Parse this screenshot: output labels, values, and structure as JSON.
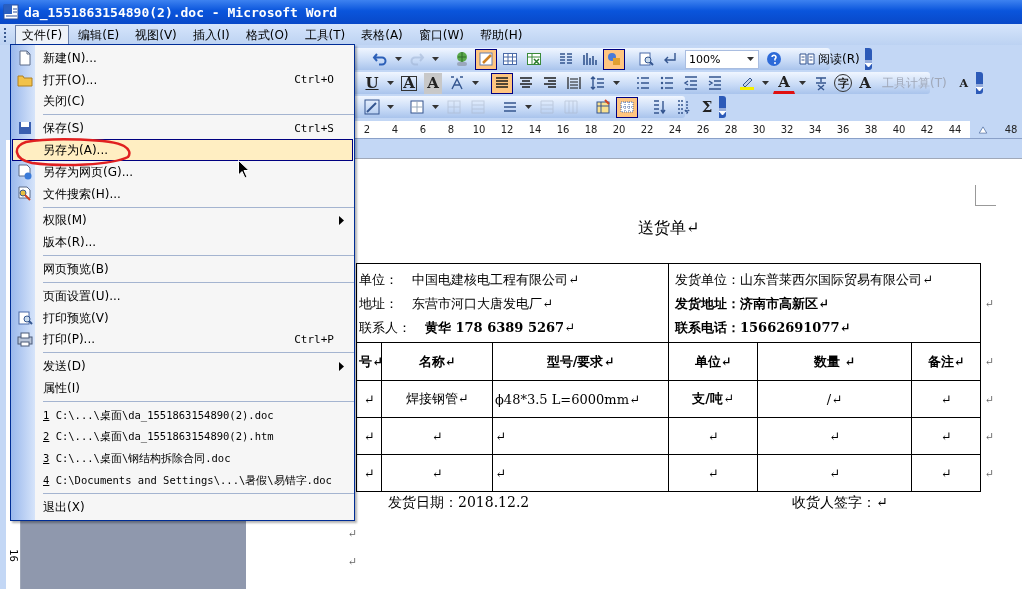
{
  "window": {
    "title": "da_1551863154890(2).doc - Microsoft Word"
  },
  "menu_bar": [
    {
      "label": "文件(F)",
      "selected": true
    },
    {
      "label": "编辑(E)",
      "selected": false
    },
    {
      "label": "视图(V)",
      "selected": false
    },
    {
      "label": "插入(I)",
      "selected": false
    },
    {
      "label": "格式(O)",
      "selected": false
    },
    {
      "label": "工具(T)",
      "selected": false
    },
    {
      "label": "表格(A)",
      "selected": false
    },
    {
      "label": "窗口(W)",
      "selected": false
    },
    {
      "label": "帮助(H)",
      "selected": false
    }
  ],
  "toolbars": [
    [
      {
        "kind": "separator"
      },
      {
        "kind": "icon",
        "selected": false,
        "disabled": false
      },
      {
        "kind": "dropdown"
      },
      {
        "kind": "icon",
        "selected": false,
        "disabled": true
      },
      {
        "kind": "dropdown"
      },
      {
        "kind": "separator"
      },
      {
        "kind": "icon",
        "selected": false,
        "disabled": false
      },
      {
        "kind": "icon",
        "selected": true,
        "disabled": false
      },
      {
        "kind": "icon",
        "selected": false,
        "disabled": false
      },
      {
        "kind": "icon",
        "selected": false,
        "disabled": false
      },
      {
        "kind": "separator"
      },
      {
        "kind": "icon",
        "selected": false,
        "disabled": false
      },
      {
        "kind": "icon",
        "selected": false,
        "disabled": false
      },
      {
        "kind": "icon",
        "selected": true,
        "disabled": false
      },
      {
        "kind": "separator"
      },
      {
        "kind": "icon",
        "selected": false,
        "disabled": false
      },
      {
        "kind": "icon",
        "selected": false,
        "disabled": false
      },
      {
        "kind": "zoom_field",
        "value": "100%"
      },
      {
        "kind": "icon",
        "selected": false,
        "disabled": false
      },
      {
        "kind": "separator"
      },
      {
        "kind": "text_button",
        "label": "阅读(R)",
        "disabled": false
      },
      {
        "kind": "chevron"
      }
    ],
    [
      {
        "kind": "glyph",
        "text": "U",
        "selected": false
      },
      {
        "kind": "dropdown"
      },
      {
        "kind": "glyph",
        "text": "A",
        "selected": false
      },
      {
        "kind": "glyph",
        "text": "A",
        "selected": false
      },
      {
        "kind": "icon",
        "selected": false,
        "disabled": false
      },
      {
        "kind": "dropdown"
      },
      {
        "kind": "separator"
      },
      {
        "kind": "icon",
        "selected": true,
        "disabled": false
      },
      {
        "kind": "icon",
        "selected": false,
        "disabled": false
      },
      {
        "kind": "icon",
        "selected": false,
        "disabled": false
      },
      {
        "kind": "icon",
        "selected": false,
        "disabled": false
      },
      {
        "kind": "icon",
        "selected": false,
        "disabled": false
      },
      {
        "kind": "dropdown"
      },
      {
        "kind": "separator"
      },
      {
        "kind": "icon",
        "selected": false,
        "disabled": false
      },
      {
        "kind": "icon",
        "selected": false,
        "disabled": false
      },
      {
        "kind": "icon",
        "selected": false,
        "disabled": false
      },
      {
        "kind": "icon",
        "selected": false,
        "disabled": false
      },
      {
        "kind": "separator"
      },
      {
        "kind": "icon",
        "selected": false,
        "disabled": false
      },
      {
        "kind": "dropdown"
      },
      {
        "kind": "glyph",
        "text": "A",
        "selected": false
      },
      {
        "kind": "dropdown"
      },
      {
        "kind": "icon",
        "selected": false,
        "disabled": false
      },
      {
        "kind": "glyph",
        "text": "字",
        "selected": false
      },
      {
        "kind": "glyph",
        "text": "A",
        "selected": false
      },
      {
        "kind": "text_button",
        "label": "工具计算(T)",
        "disabled": true
      },
      {
        "kind": "glyph",
        "text": "A",
        "selected": false
      },
      {
        "kind": "chevron"
      }
    ],
    [
      {
        "kind": "icon",
        "selected": false,
        "disabled": false
      },
      {
        "kind": "dropdown"
      },
      {
        "kind": "separator"
      },
      {
        "kind": "icon",
        "selected": false,
        "disabled": false
      },
      {
        "kind": "dropdown"
      },
      {
        "kind": "icon",
        "selected": false,
        "disabled": true
      },
      {
        "kind": "icon",
        "selected": false,
        "disabled": true
      },
      {
        "kind": "separator"
      },
      {
        "kind": "icon",
        "selected": false,
        "disabled": false
      },
      {
        "kind": "dropdown"
      },
      {
        "kind": "icon",
        "selected": false,
        "disabled": true
      },
      {
        "kind": "icon",
        "selected": false,
        "disabled": true
      },
      {
        "kind": "separator"
      },
      {
        "kind": "icon",
        "selected": false,
        "disabled": false
      },
      {
        "kind": "icon",
        "selected": true,
        "disabled": false
      },
      {
        "kind": "separator"
      },
      {
        "kind": "icon",
        "selected": false,
        "disabled": false
      },
      {
        "kind": "icon",
        "selected": false,
        "disabled": false
      },
      {
        "kind": "glyph",
        "text": "Σ",
        "selected": false
      },
      {
        "kind": "chevron"
      }
    ]
  ],
  "ruler": {
    "marks": [
      "2",
      "4",
      "6",
      "8",
      "10",
      "12",
      "14",
      "16",
      "18",
      "20",
      "22",
      "24",
      "26",
      "28",
      "30",
      "32",
      "34",
      "36",
      "38",
      "40",
      "42",
      "44",
      "48"
    ],
    "vertical_marks": [
      "16"
    ]
  },
  "file_menu": {
    "items": [
      {
        "kind": "item",
        "label": "新建(N)...",
        "submenu": false,
        "selected": false
      },
      {
        "kind": "item",
        "label": "打开(O)...",
        "shortcut": "Ctrl+O",
        "submenu": false,
        "selected": false
      },
      {
        "kind": "item",
        "label": "关闭(C)",
        "submenu": false,
        "selected": false
      },
      {
        "kind": "separator"
      },
      {
        "kind": "item",
        "label": "保存(S)",
        "shortcut": "Ctrl+S",
        "submenu": false,
        "selected": false
      },
      {
        "kind": "item",
        "label": "另存为(A)...",
        "submenu": false,
        "selected": true
      },
      {
        "kind": "item",
        "label": "另存为网页(G)...",
        "submenu": false,
        "selected": false
      },
      {
        "kind": "item",
        "label": "文件搜索(H)...",
        "submenu": false,
        "selected": false
      },
      {
        "kind": "separator"
      },
      {
        "kind": "item",
        "label": "权限(M)",
        "submenu": true,
        "selected": false
      },
      {
        "kind": "item",
        "label": "版本(R)...",
        "submenu": false,
        "selected": false
      },
      {
        "kind": "separator"
      },
      {
        "kind": "item",
        "label": "网页预览(B)",
        "submenu": false,
        "selected": false
      },
      {
        "kind": "separator"
      },
      {
        "kind": "item",
        "label": "页面设置(U)...",
        "submenu": false,
        "selected": false
      },
      {
        "kind": "item",
        "label": "打印预览(V)",
        "submenu": false,
        "selected": false
      },
      {
        "kind": "item",
        "label": "打印(P)...",
        "shortcut": "Ctrl+P",
        "submenu": false,
        "selected": false
      },
      {
        "kind": "separator"
      },
      {
        "kind": "item",
        "label": "发送(D)",
        "submenu": true,
        "selected": false
      },
      {
        "kind": "item",
        "label": "属性(I)",
        "submenu": false,
        "selected": false
      },
      {
        "kind": "separator"
      },
      {
        "kind": "recent",
        "number": "1",
        "label": "C:\\...\\桌面\\da_1551863154890(2).doc",
        "selected": false
      },
      {
        "kind": "recent",
        "number": "2",
        "label": "C:\\...\\桌面\\da_1551863154890(2).htm",
        "selected": false
      },
      {
        "kind": "recent",
        "number": "3",
        "label": "C:\\...\\桌面\\钢结构拆除合同.doc",
        "selected": false
      },
      {
        "kind": "recent",
        "number": "4",
        "label": "C:\\Documents and Settings\\...\\暑假\\易错字.doc",
        "selected": false
      },
      {
        "kind": "separator"
      },
      {
        "kind": "item",
        "label": "退出(X)",
        "submenu": false,
        "selected": false
      }
    ]
  },
  "document": {
    "title": "送货单↵",
    "consignee": [
      {
        "label": "单位：",
        "value": "中国电建核电工程有限公司↵"
      },
      {
        "label": "地址：",
        "value": "东营市河口大唐发电厂↵"
      },
      {
        "label": "联系人：",
        "value": "**黄华 178 6389 5267**↵"
      }
    ],
    "shipper": [
      {
        "text": "发货单位：山东普莱西尔国际贸易有限公司↵",
        "bold": false
      },
      {
        "text": "发货地址：济南市高新区↵",
        "bold": true
      },
      {
        "text": "联系电话：15662691077↵",
        "bold": true
      }
    ],
    "columns": [
      "号↵",
      "名称↵",
      "型号/要求↵",
      "单位↵",
      "数量 ↵",
      "备注↵"
    ],
    "rows": [
      [
        "↵",
        "焊接钢管↵",
        "ϕ48*3.5 L=6000mm↵",
        "**支/吨**↵",
        "/↵",
        "↵"
      ],
      [
        "↵",
        "↵",
        "↵",
        "↵",
        "↵",
        "↵"
      ],
      [
        "↵",
        "↵",
        "↵",
        "↵",
        "↵",
        "↵"
      ]
    ],
    "row_end_marks": [
      "↵",
      "↵",
      "↵",
      "↵",
      "↵"
    ],
    "date": "发货日期：2018.12.2",
    "signature": "收货人签字：↵",
    "paragraph_marks": [
      "↵",
      "↵"
    ]
  }
}
